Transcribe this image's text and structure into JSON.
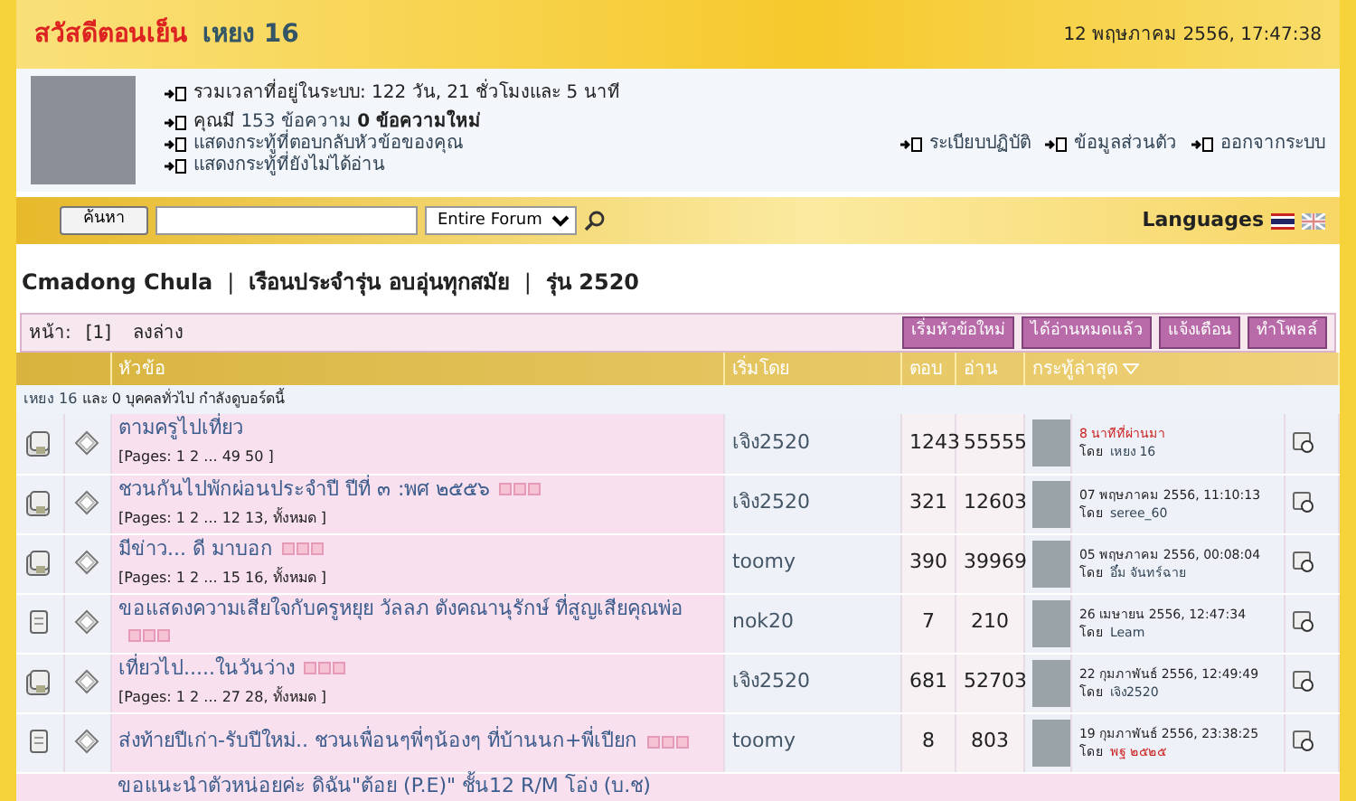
{
  "header": {
    "greeting": "สวัสดีตอนเย็น",
    "user": "เหยง 16",
    "datetime": "12 พฤษภาคม 2556, 17:47:38"
  },
  "profile": {
    "online_time": "รวมเวลาที่อยู่ในระบบ: 122 วัน, 21 ชั่วโมงและ 5 นาที",
    "messages_prefix": "คุณมี",
    "messages_count": "153 ข้อความ",
    "messages_new": "0 ข้อความใหม่",
    "links": [
      "แสดงกระทู้ที่ตอบกลับหัวข้อของคุณ",
      "แสดงกระทู้ที่ยังไม่ได้อ่าน"
    ],
    "actions": [
      "ระเบียบปฏิบัติ",
      "ข้อมูลส่วนตัว",
      "ออกจากระบบ"
    ]
  },
  "search": {
    "button": "ค้นหา",
    "scope": "Entire Forum",
    "languages": "Languages"
  },
  "breadcrumb": [
    "Cmadong Chula",
    "เรือนประจำรุ่น อบอุ่นทุกสมัย",
    "รุ่น 2520"
  ],
  "breadcrumb_separator": "|",
  "pager": {
    "label": "หน้า:",
    "current": "[1]",
    "bottom": "ลงล่าง",
    "buttons": [
      "เริ่มหัวข้อใหม่",
      "ได้อ่านหมดแล้ว",
      "แจ้งเตือน",
      "ทำโพลล์"
    ]
  },
  "table": {
    "columns": [
      "หัวข้อ",
      "เริ่มโดย",
      "ตอบ",
      "อ่าน",
      "กระทู้ล่าสุด"
    ],
    "online": {
      "user": "เหยง 16",
      "text": "และ 0 บุคคลทั่วไป กำลังดูบอร์ดนี้"
    },
    "rows": [
      {
        "kind": "hot",
        "title": "ตามครูไปเที่ยว",
        "pages": "[Pages: 1 2 ... 49 50 ]",
        "page_icons": false,
        "starter": "เจิง2520",
        "replies": "1243",
        "views": "55555",
        "last_time": "8 นาทีที่ผ่านมา",
        "time_new": true,
        "by": "โดย",
        "last_user": "เหยง 16",
        "user_highlight": false
      },
      {
        "kind": "hot",
        "title": "ชวนกันไปพักผ่อนประจำปี ปีที่ ๓ :พศ ๒๕๕๖",
        "pages": "[Pages: 1 2 ... 12 13, ทั้งหมด ]",
        "page_icons": true,
        "starter": "เจิง2520",
        "replies": "321",
        "views": "12603",
        "last_time": "07 พฤษภาคม 2556, 11:10:13",
        "time_new": false,
        "by": "โดย",
        "last_user": "seree_60",
        "user_highlight": false
      },
      {
        "kind": "hot",
        "title": "มีข่าว... ดี มาบอก",
        "pages": "[Pages: 1 2 ... 15 16, ทั้งหมด ]",
        "page_icons": true,
        "starter": "toomy",
        "replies": "390",
        "views": "39969",
        "last_time": "05 พฤษภาคม 2556, 00:08:04",
        "time_new": false,
        "by": "โดย",
        "last_user": "อึ๋ม จันทร์ฉาย",
        "user_highlight": false
      },
      {
        "kind": "normal",
        "title": "ขอแสดงความเสียใจกับครูหยุย วัลลภ ตังคณานุรักษ์ ที่สูญเสียคุณพ่อ",
        "page_icons": true,
        "starter": "nok20",
        "replies": "7",
        "views": "210",
        "last_time": "26 เมษายน 2556, 12:47:34",
        "time_new": false,
        "by": "โดย",
        "last_user": "Leam",
        "user_highlight": false
      },
      {
        "kind": "hot",
        "title": "เที่ยวไป.....ในวันว่าง",
        "pages": "[Pages: 1 2 ... 27 28, ทั้งหมด ]",
        "page_icons": true,
        "starter": "เจิง2520",
        "replies": "681",
        "views": "52703",
        "last_time": "22 กุมภาพันธ์ 2556, 12:49:49",
        "time_new": false,
        "by": "โดย",
        "last_user": "เจิง2520",
        "user_highlight": false
      },
      {
        "kind": "normal",
        "title": "ส่งท้ายปีเก่า-รับปีใหม่.. ชวนเพื่อนๆพี่ๆน้องๆ ที่บ้านนก+พี่เปียก",
        "page_icons": true,
        "starter": "toomy",
        "replies": "8",
        "views": "803",
        "last_time": "19 กุมภาพันธ์ 2556, 23:38:25",
        "time_new": false,
        "by": "โดย",
        "last_user": "พฐ ๒๕๒๕",
        "user_highlight": true
      }
    ],
    "partial_row_title": "ขอแนะนำตัวหน่อยค่ะ ดิฉัน\"ต้อย (P.E)\" ชั้น12 R/M โอ่ง (บ.ช)"
  }
}
